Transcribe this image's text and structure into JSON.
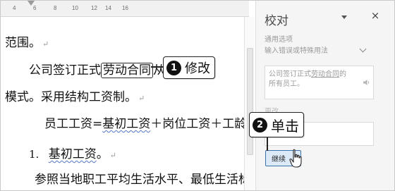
{
  "ruler": {
    "ticks": [
      "4",
      "6",
      "8",
      "10",
      "12",
      "14",
      "16"
    ]
  },
  "document": {
    "line1": "范围。",
    "line2_pre": "公司签订正式",
    "line2_box": "劳动合同",
    "line2_post": "从",
    "line3": "模式。采用结构工资制。",
    "line4_a": "员工工资=",
    "line4_b": "基初工资",
    "line4_c": "＋岗位工资＋工龄",
    "line5_num": "1.",
    "line5_text": "基初工资",
    "line5_tail": "。",
    "line6": "参照当地职工平均生活水平、最低生活标",
    "para_mark": "↵"
  },
  "callouts": [
    {
      "number": "1",
      "text": "修改"
    },
    {
      "number": "2",
      "text": "单击"
    }
  ],
  "pane": {
    "title": "校对",
    "close": "×",
    "section_label": "通用选项",
    "section_sub": "输入错误或特殊用法",
    "sugg_line1_pre": "公司签订正式",
    "sugg_line1_u": "劳动合同",
    "sugg_line1_post": "的",
    "sugg_line2": "所有员工。",
    "faded_label": "更改",
    "continue_button": "继续"
  },
  "colors": {
    "accent": "#3d73ad",
    "button_bg": "#dceaf7",
    "pane_bg": "#f5f5f5"
  },
  "icons": [
    "dropdown-icon",
    "close-icon",
    "chevron-down-icon",
    "speaker-icon",
    "cursor-icon"
  ]
}
